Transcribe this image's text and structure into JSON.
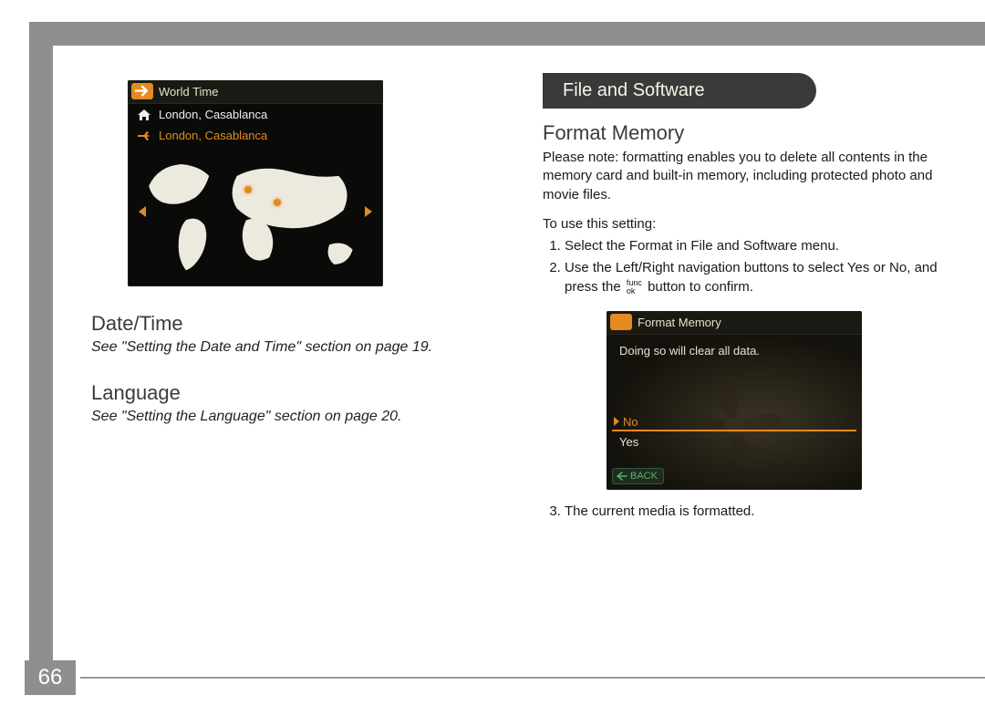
{
  "page_number": "66",
  "left": {
    "screenshot1": {
      "title": "World Time",
      "home_location": "London, Casablanca",
      "travel_location": "London, Casablanca"
    },
    "date_time": {
      "heading": "Date/Time",
      "note": "See \"Setting the Date and Time\" section on page 19."
    },
    "language": {
      "heading": "Language",
      "note": "See \"Setting the Language\" section on page 20."
    }
  },
  "right": {
    "pill": "File and Software",
    "format_memory": {
      "heading": "Format Memory",
      "warning": "Please note:  formatting enables you to delete all contents in the memory card and built-in memory, including protected photo and movie files.",
      "intro": "To use this setting:",
      "step1": "Select the Format in File and Software menu.",
      "step2_a": "Use the Left/Right navigation buttons to select Yes or No, and press the ",
      "step2_b": " button to confirm.",
      "func_top": "func",
      "func_bot": "ok",
      "step3": "The current media is formatted."
    },
    "screenshot2": {
      "title": "Format Memory",
      "message": "Doing so will clear all data.",
      "option_no": "No",
      "option_yes": "Yes",
      "back": "BACK"
    }
  }
}
